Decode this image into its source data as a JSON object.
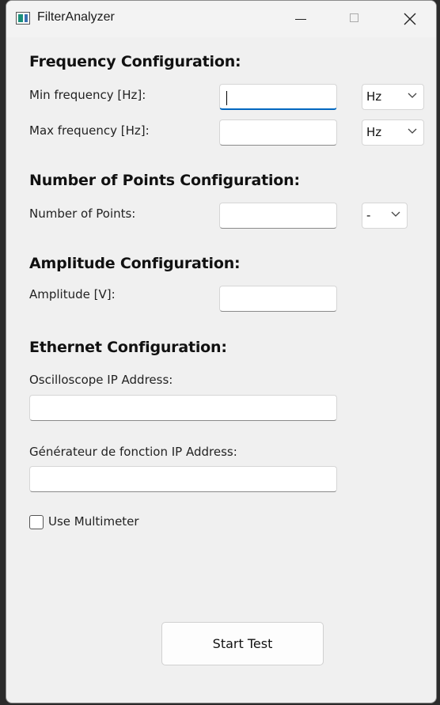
{
  "window": {
    "title": "FilterAnalyzer"
  },
  "frequency": {
    "heading": "Frequency Configuration:",
    "min_label": "Min frequency [Hz]:",
    "min_value": "",
    "min_unit": "Hz",
    "max_label": "Max frequency [Hz]:",
    "max_value": "",
    "max_unit": "Hz"
  },
  "points": {
    "heading": "Number of Points Configuration:",
    "label": "Number of Points:",
    "value": "",
    "unit": "-"
  },
  "amplitude": {
    "heading": "Amplitude Configuration:",
    "label": "Amplitude [V]:",
    "value": ""
  },
  "ethernet": {
    "heading": "Ethernet Configuration:",
    "osc_label": "Oscilloscope IP Address:",
    "osc_value": "",
    "gen_label": "Générateur de fonction IP Address:",
    "gen_value": ""
  },
  "multimeter": {
    "label": "Use Multimeter",
    "checked": false
  },
  "actions": {
    "start_label": "Start Test"
  }
}
